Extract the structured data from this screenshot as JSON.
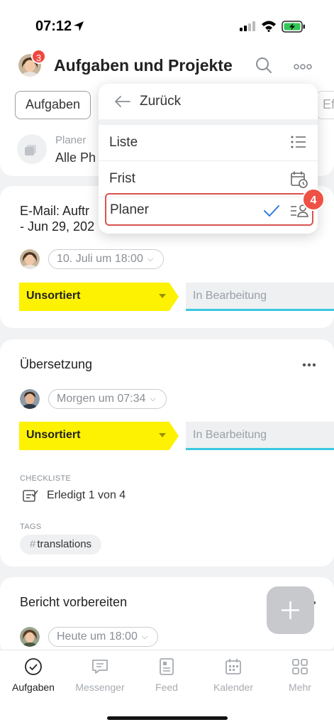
{
  "status_bar": {
    "time": "07:12"
  },
  "header": {
    "title": "Aufgaben und Projekte",
    "avatar_badge": "3",
    "filter_pill": "Aufgaben",
    "partial_pill": "Ef",
    "planer_label": "Planer",
    "planer_value": "Alle Ph"
  },
  "menu": {
    "back_label": "Zurück",
    "items": [
      {
        "label": "Liste",
        "icon": "list-icon"
      },
      {
        "label": "Frist",
        "icon": "calendar-clock-icon"
      },
      {
        "label": "Planer",
        "icon": "planner-person-icon",
        "selected": true
      }
    ],
    "step_badge": "4"
  },
  "cards": [
    {
      "title_line1": "E-Mail: Auftr",
      "title_line2": "- Jun 29, 202",
      "date": "10. Juli um 18:00",
      "stage": "Unsortiert",
      "next_stage": "In Bearbeitung"
    },
    {
      "title": "Übersetzung",
      "date": "Morgen um 07:34",
      "stage": "Unsortiert",
      "next_stage": "In Bearbeitung",
      "checklist_label": "CHECKLISTE",
      "checklist_text": "Erledigt 1 von 4",
      "tags_label": "TAGS",
      "tag": "translations"
    },
    {
      "title": "Bericht vorbereiten",
      "date": "Heute um 18:00"
    }
  ],
  "bottom_nav": [
    {
      "label": "Aufgaben",
      "icon": "check-circle-icon",
      "active": true
    },
    {
      "label": "Messenger",
      "icon": "chat-icon"
    },
    {
      "label": "Feed",
      "icon": "feed-icon"
    },
    {
      "label": "Kalender",
      "icon": "calendar-icon"
    },
    {
      "label": "Mehr",
      "icon": "grid-icon"
    }
  ],
  "colors": {
    "stage_yellow": "#fdf202",
    "stage_accent": "#3bc8e0",
    "badge_red": "#f0473f",
    "check_blue": "#2f7de1"
  }
}
